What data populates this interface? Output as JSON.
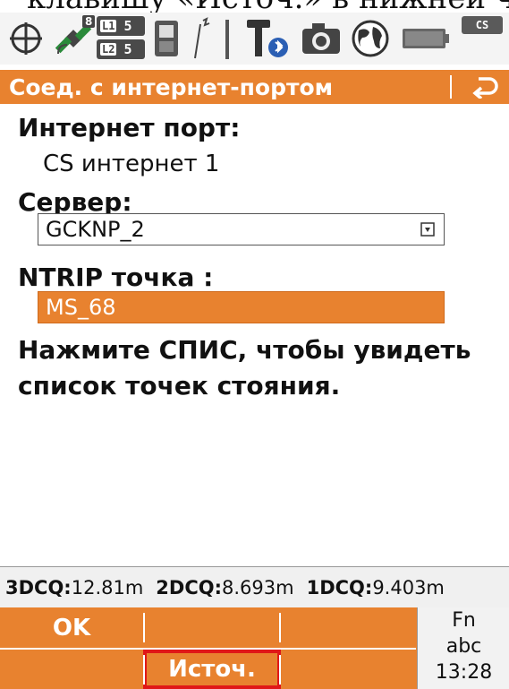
{
  "caption_fragment": "клавишу «Источ.» в нижней части эк",
  "status_bar": {
    "sats_l1_count_a": "8",
    "sats_l1_count_b": "5",
    "sats_l2_count": "5",
    "l1_label": "L1",
    "l2_label": "L2",
    "cs_badge": "CS"
  },
  "title_bar": {
    "title": "Соед. с интернет-портом"
  },
  "form": {
    "internet_port_label": "Интернет порт:",
    "internet_port_value": "CS интернет 1",
    "server_label": "Сервер:",
    "server_value": "GCKNP_2",
    "ntrip_label": "NTRIP точка :",
    "ntrip_value": "MS_68",
    "message": "Нажмите СПИС, чтобы увидеть список точек стояния."
  },
  "quality": {
    "d3_label": "3DCQ:",
    "d3_value": "12.81m",
    "d2_label": "2DCQ:",
    "d2_value": "8.693m",
    "d1_label": "1DCQ:",
    "d1_value": "9.403m"
  },
  "softkeys": {
    "f1": "OK",
    "f2": "",
    "f3": "",
    "f4": "",
    "f5": "Источ.",
    "f6": "",
    "fn_label": "Fn",
    "input_mode": "abc",
    "time": "13:28"
  },
  "colors": {
    "accent": "#e8822f",
    "highlight_border": "#e01818"
  }
}
